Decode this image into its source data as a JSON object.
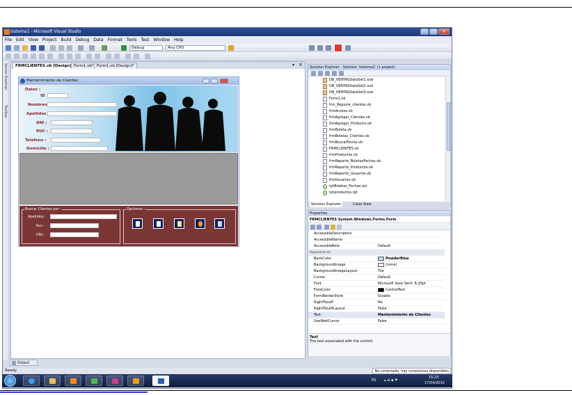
{
  "window": {
    "title": "sistema1 - Microsoft Visual Studio"
  },
  "menu": [
    "File",
    "Edit",
    "View",
    "Project",
    "Build",
    "Debug",
    "Data",
    "Format",
    "Tools",
    "Test",
    "Window",
    "Help"
  ],
  "toolbar": {
    "config": "Debug",
    "platform": "Any CPU"
  },
  "left_strip": {
    "server_explorer": "Server Explorer",
    "toolbox": "Toolbox"
  },
  "doc_tabs": [
    "FRMCLIENTES.vb [Design]",
    "Form1.vb*",
    "Form1.vb [Design]*"
  ],
  "form": {
    "title": "Mantenimiento de Clientes",
    "group_datos": "Datos :",
    "labels": {
      "id": "ID",
      "nombres": "Nombres :",
      "apellidos": "Apellidos :",
      "dni": "DNI :",
      "ruc": "RUC :",
      "telefono": "Telefono :",
      "domicilio": "Domicilio :"
    },
    "search": {
      "legend": "Buscar Clientes por :",
      "apellidos": "Apellidos :",
      "ruc": "Ruc :",
      "dni": "DNI :"
    },
    "options_legend": "Opciones :"
  },
  "solution_explorer": {
    "header": "Solution Explorer - Solution 'sistema1' (1 project)",
    "items": [
      {
        "name": "DB_VENTASDataSet1.xsd",
        "kind": "xsd"
      },
      {
        "name": "DB_VENTASDataSet2.xsd",
        "kind": "xsd"
      },
      {
        "name": "DB_VENTASDataSet3.xsd",
        "kind": "xsd"
      },
      {
        "name": "Form1.vb",
        "kind": "vb"
      },
      {
        "name": "frm_Reporte_clientes.vb",
        "kind": "vb"
      },
      {
        "name": "frmAcceso.vb",
        "kind": "vb"
      },
      {
        "name": "frmAgregar_Clientes.vb",
        "kind": "vb"
      },
      {
        "name": "frmAgregar_Producto.vb",
        "kind": "vb"
      },
      {
        "name": "frmBoleta.vb",
        "kind": "vb"
      },
      {
        "name": "frmBoletas_Clientes.vb",
        "kind": "vb"
      },
      {
        "name": "frmBuscarFecha.vb",
        "kind": "vb"
      },
      {
        "name": "FRMCLIENTES.vb",
        "kind": "vb"
      },
      {
        "name": "frmProductos.vb",
        "kind": "vb"
      },
      {
        "name": "frmReporte_BoletasFechas.vb",
        "kind": "vb"
      },
      {
        "name": "frmReporte_Productos.vb",
        "kind": "vb"
      },
      {
        "name": "frmReporte_Usuarios.vb",
        "kind": "vb"
      },
      {
        "name": "frmUsuarios.vb",
        "kind": "vb"
      },
      {
        "name": "rptBoletas_Fechas.rpt",
        "kind": "rpt"
      },
      {
        "name": "rptproductos.rpt",
        "kind": "rpt"
      }
    ],
    "tabs": [
      "Solution Explorer",
      "Class View"
    ]
  },
  "properties": {
    "header": "Properties",
    "object": "FRMCLIENTES System.Windows.Forms.Form",
    "rows": [
      {
        "name": "AccessibleDescription",
        "value": "",
        "type": "prop"
      },
      {
        "name": "AccessibleName",
        "value": "",
        "type": "prop"
      },
      {
        "name": "AccessibleRole",
        "value": "Default",
        "type": "prop"
      },
      {
        "name": "Appearance",
        "value": "",
        "type": "cat"
      },
      {
        "name": "BackColor",
        "value": "PowderBlue",
        "type": "prop",
        "swatch": "#b0e0e6",
        "bold": true
      },
      {
        "name": "BackgroundImage",
        "value": "(none)",
        "type": "prop",
        "swatch": "#ffffff"
      },
      {
        "name": "BackgroundImageLayout",
        "value": "Tile",
        "type": "prop"
      },
      {
        "name": "Cursor",
        "value": "Default",
        "type": "prop"
      },
      {
        "name": "Font",
        "value": "Microsoft Sans Serif; 8,25pt",
        "type": "prop"
      },
      {
        "name": "ForeColor",
        "value": "ControlText",
        "type": "prop",
        "swatch": "#000000"
      },
      {
        "name": "FormBorderStyle",
        "value": "Sizable",
        "type": "prop"
      },
      {
        "name": "RightToLeft",
        "value": "No",
        "type": "prop"
      },
      {
        "name": "RightToLeftLayout",
        "value": "False",
        "type": "prop"
      },
      {
        "name": "Text",
        "value": "Mantenimiento de Clientes",
        "type": "prop",
        "bold": true,
        "selected": true
      },
      {
        "name": "UseWaitCursor",
        "value": "False",
        "type": "prop"
      }
    ],
    "desc_title": "Text",
    "desc_text": "The text associated with the control."
  },
  "output_tab": "Output",
  "status": {
    "ready": "Ready",
    "message": "No conectado: hay conexiones disponibles"
  },
  "taskbar": {
    "lang": "ES",
    "time": "15:23",
    "date": "17/04/2010"
  }
}
